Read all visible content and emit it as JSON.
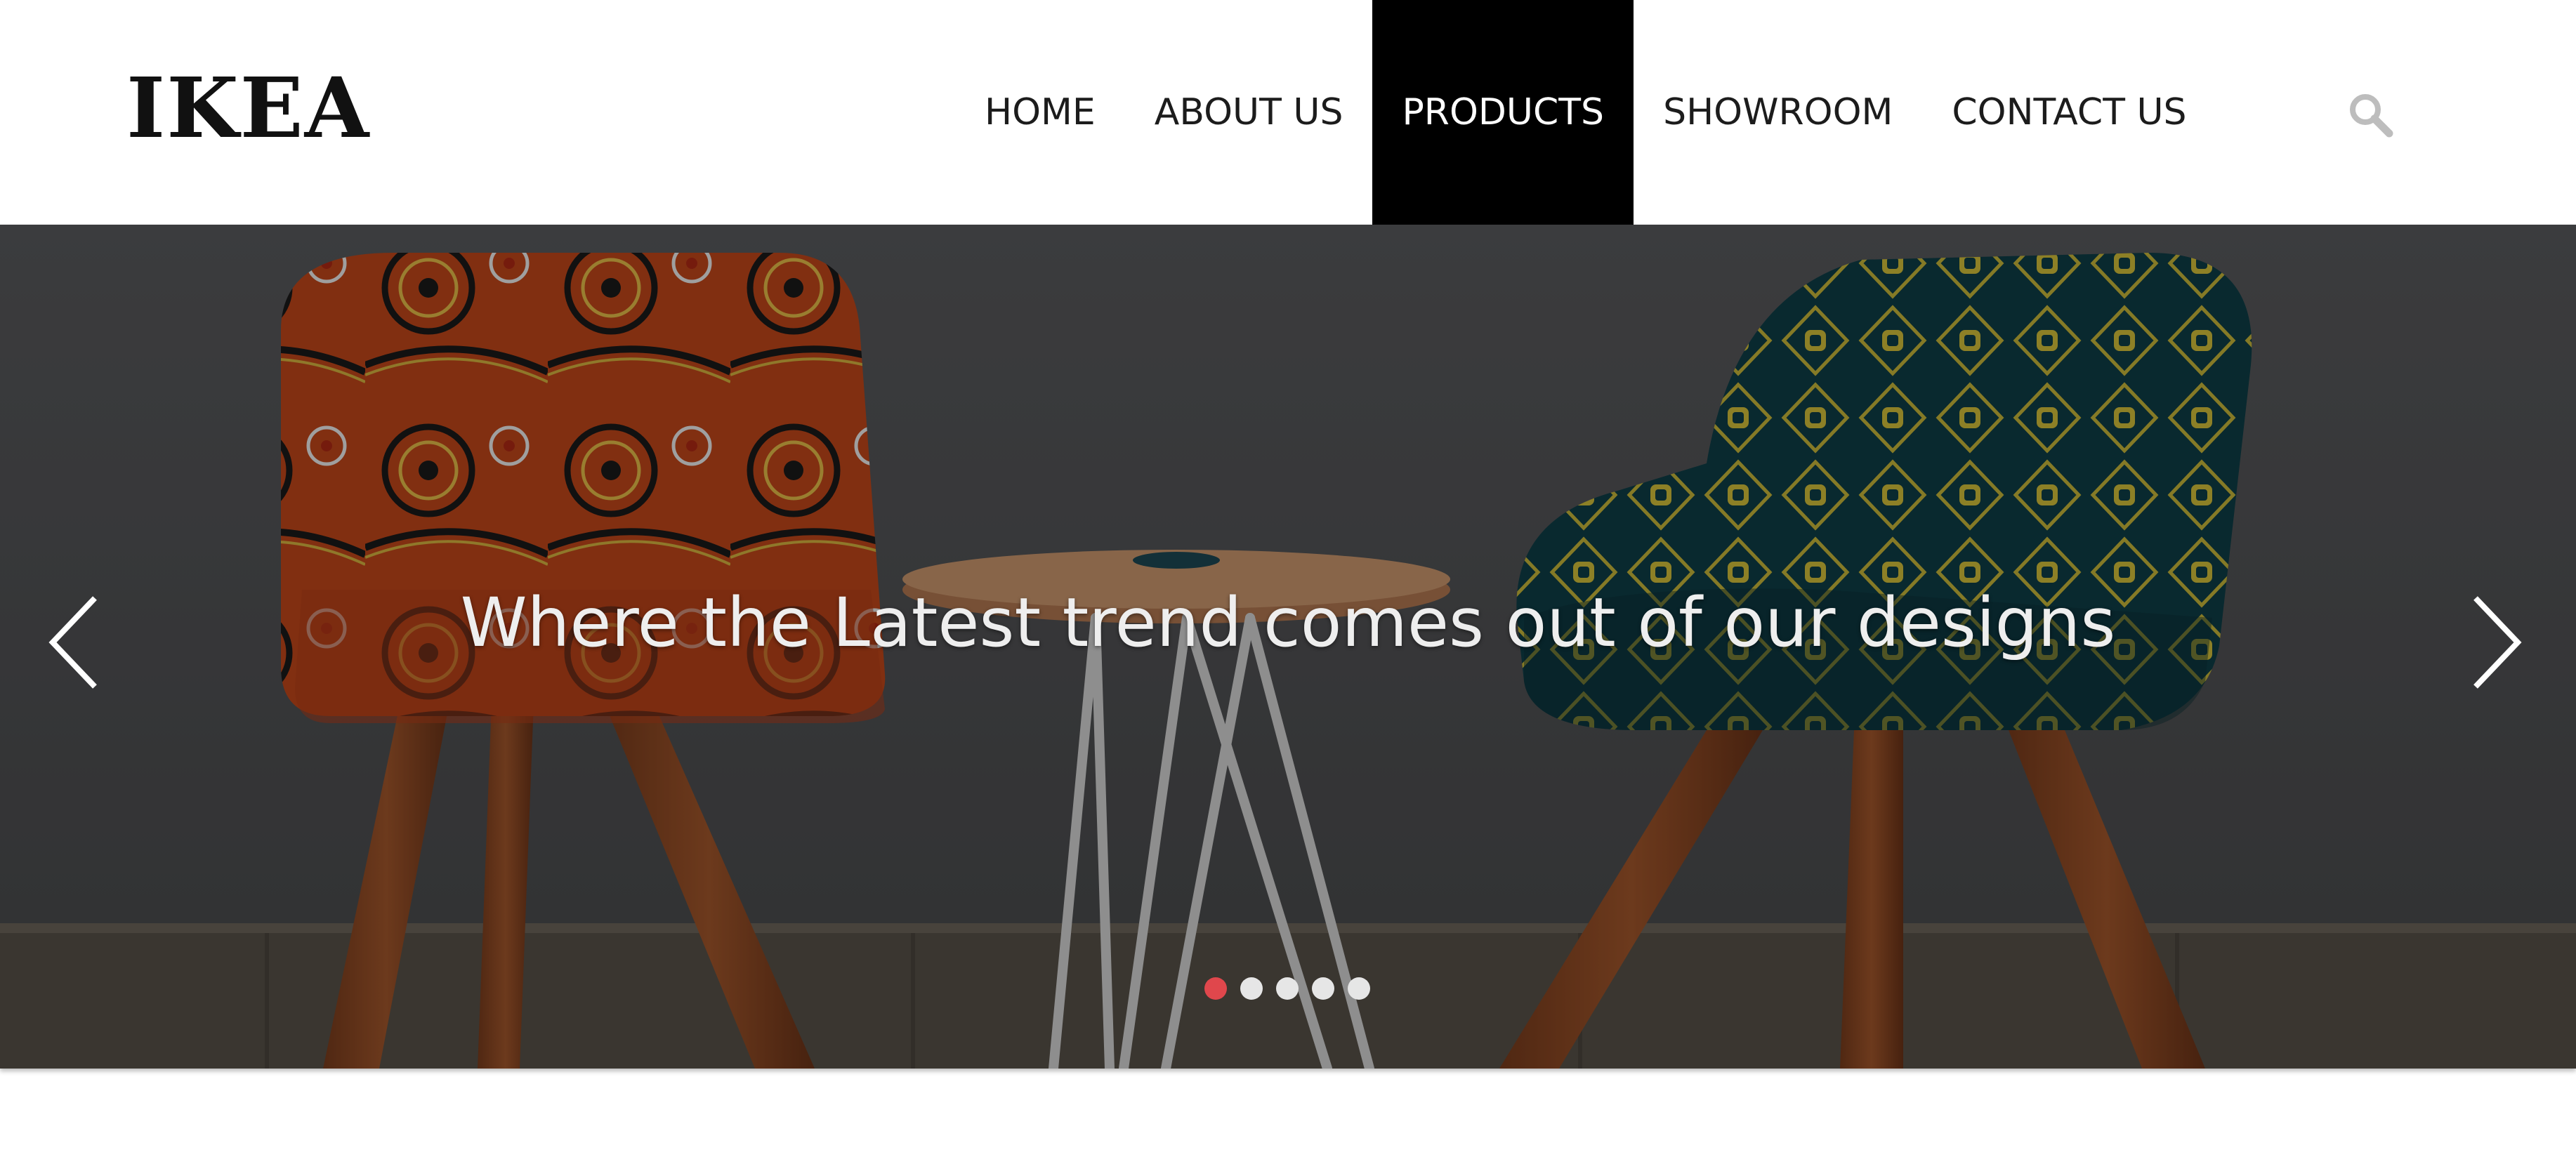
{
  "header": {
    "logo": "IKEA",
    "nav": [
      {
        "label": "HOME",
        "active": false
      },
      {
        "label": "ABOUT US",
        "active": false
      },
      {
        "label": "PRODUCTS",
        "active": true
      },
      {
        "label": "SHOWROOM",
        "active": false
      },
      {
        "label": "CONTACT US",
        "active": false
      }
    ],
    "search_icon": "search-icon"
  },
  "hero": {
    "caption": "Where the Latest trend comes out of our designs",
    "prev_icon": "chevron-left-icon",
    "next_icon": "chevron-right-icon",
    "slide_count": 5,
    "active_slide": 1
  },
  "colors": {
    "nav_active_bg": "#000000",
    "nav_active_text": "#ffffff",
    "dot_active": "#e0474c",
    "dot_inactive": "#e6e6e6",
    "search_icon": "#bdbdbd"
  }
}
